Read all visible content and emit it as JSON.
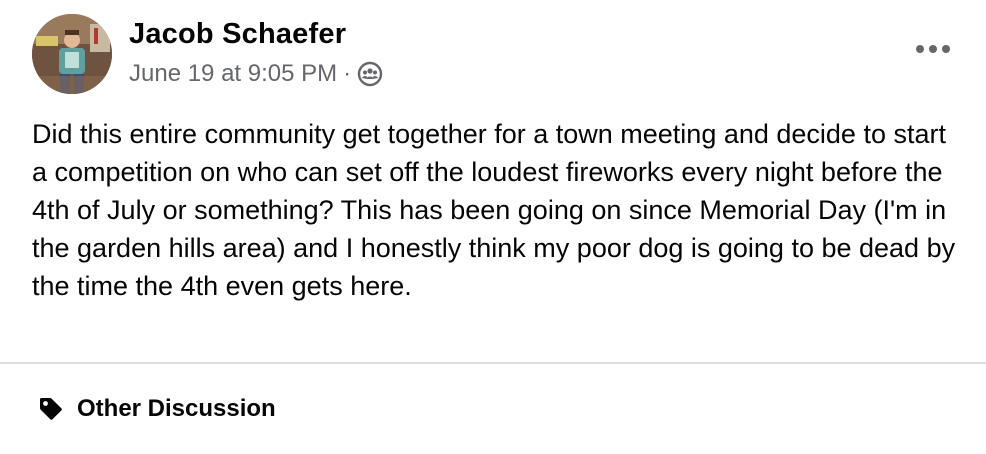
{
  "post": {
    "author_name": "Jacob Schaefer",
    "timestamp": "June 19 at 9:05 PM",
    "separator": "·",
    "audience_icon": "group-icon",
    "more_icon": "more-options-icon",
    "body": "Did this entire community get together for a town meeting and decide to start a competition on who can set off the loudest fireworks every night before the 4th of July or something? This has been going on since Memorial Day (I'm in the garden hills area) and I honestly think my poor dog is going to be dead by the time the 4th even gets here."
  },
  "topic": {
    "icon": "tag-icon",
    "label": "Other Discussion"
  },
  "colors": {
    "primary_text": "#050505",
    "secondary_text": "#65676b",
    "divider": "#dadde1",
    "background": "#ffffff"
  }
}
